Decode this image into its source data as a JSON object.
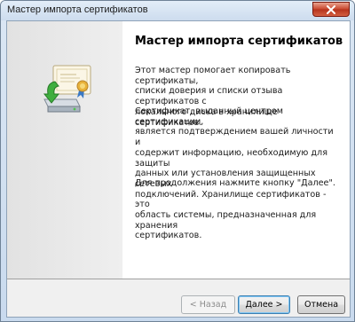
{
  "window": {
    "title": "Мастер импорта сертификатов"
  },
  "content": {
    "heading": "Мастер импорта сертификатов",
    "para1": "Этот мастер помогает копировать сертификаты,\nсписки доверия и списки отзыва сертификатов с\nлокального диска в хранилище сертификатов.",
    "para2": "Сертификат, выданный центром сертификации,\nявляется подтверждением вашей личности и\nсодержит информацию, необходимую для защиты\nданных или установления защищенных сетевых\nподключений. Хранилище сертификатов - это\nобласть системы, предназначенная для хранения\nсертификатов.",
    "para3": "Для продолжения нажмите кнопку \"Далее\"."
  },
  "buttons": {
    "back": "< Назад",
    "next": "Далее >",
    "cancel": "Отмена"
  },
  "icons": {
    "sidebar": "certificate-import-icon",
    "close": "close-icon"
  },
  "colors": {
    "accent": "#3c7fb1",
    "close": "#c8452c"
  }
}
